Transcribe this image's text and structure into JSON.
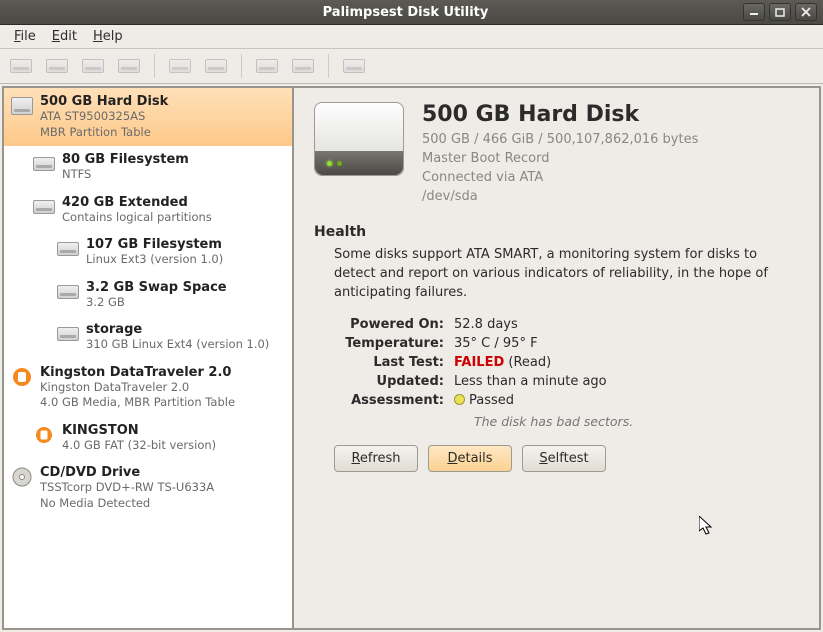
{
  "window": {
    "title": "Palimpsest Disk Utility"
  },
  "menu": {
    "file": "File",
    "edit": "Edit",
    "help": "Help"
  },
  "sidebar": {
    "items": [
      {
        "title": "500 GB Hard Disk",
        "sub1": "ATA ST9500325AS",
        "sub2": "MBR Partition Table"
      },
      {
        "title": "80 GB Filesystem",
        "sub1": "NTFS"
      },
      {
        "title": "420 GB Extended",
        "sub1": "Contains logical partitions"
      },
      {
        "title": "107 GB Filesystem",
        "sub1": "Linux Ext3 (version 1.0)"
      },
      {
        "title": "3.2 GB Swap Space",
        "sub1": "3.2 GB"
      },
      {
        "title": "storage",
        "sub1": "310 GB Linux Ext4 (version 1.0)"
      },
      {
        "title": "Kingston DataTraveler 2.0",
        "sub1": "Kingston DataTraveler 2.0",
        "sub2": "4.0 GB Media, MBR Partition Table"
      },
      {
        "title": "KINGSTON",
        "sub1": "4.0 GB FAT (32-bit version)"
      },
      {
        "title": "CD/DVD Drive",
        "sub1": "TSSTcorp DVD+-RW TS-U633A",
        "sub2": "No Media Detected"
      }
    ]
  },
  "detail": {
    "title": "500 GB Hard Disk",
    "meta1": "500 GB / 466 GiB / 500,107,862,016 bytes",
    "meta2": "Master Boot Record",
    "meta3": "Connected via ATA",
    "meta4": "/dev/sda",
    "health_heading": "Health",
    "health_body": "Some disks support ATA SMART, a monitoring system for disks to detect and report on various indicators of reliability, in the hope of anticipating failures.",
    "kv": {
      "powered_on_k": "Powered On:",
      "powered_on_v": "52.8 days",
      "temp_k": "Temperature:",
      "temp_v": "35° C / 95° F",
      "last_test_k": "Last Test:",
      "last_test_fail": "FAILED",
      "last_test_extra": " (Read)",
      "updated_k": "Updated:",
      "updated_v": "Less than a minute ago",
      "assessment_k": "Assessment:",
      "assessment_v": "Passed"
    },
    "note": "The disk has bad sectors.",
    "buttons": {
      "refresh": "Refresh",
      "details": "Details",
      "selftest": "Selftest"
    }
  }
}
